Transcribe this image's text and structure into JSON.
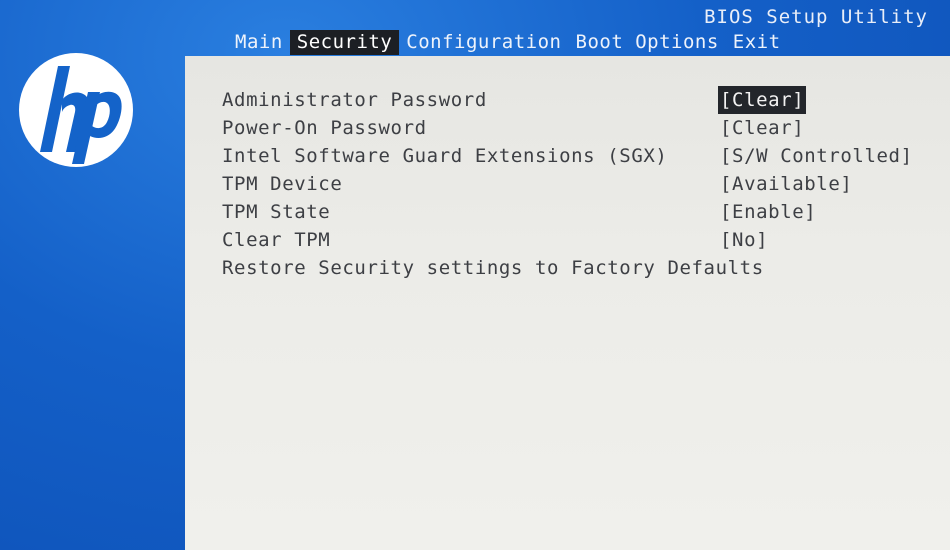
{
  "header": {
    "title": "BIOS Setup Utility"
  },
  "tabs": [
    {
      "label": "Main"
    },
    {
      "label": "Security"
    },
    {
      "label": "Configuration"
    },
    {
      "label": "Boot Options"
    },
    {
      "label": "Exit"
    }
  ],
  "active_tab": "Security",
  "logo": {
    "text": "hp"
  },
  "colors": {
    "background_blue": "#1460c8",
    "panel": "#ececE8",
    "highlight": "#23262b",
    "text": "#3d3f44"
  },
  "security": {
    "items": [
      {
        "label": "Administrator Password",
        "value": "[Clear]",
        "selected": true
      },
      {
        "label": "Power-On Password",
        "value": "[Clear]"
      },
      {
        "label": "Intel Software Guard Extensions (SGX)",
        "value": "[S/W Controlled]"
      },
      {
        "label": "TPM Device",
        "value": "[Available]"
      },
      {
        "label": "TPM State",
        "value": "[Enable]"
      },
      {
        "label": "Clear TPM",
        "value": "[No]"
      },
      {
        "label": "Restore Security settings to Factory Defaults",
        "value": ""
      }
    ]
  }
}
